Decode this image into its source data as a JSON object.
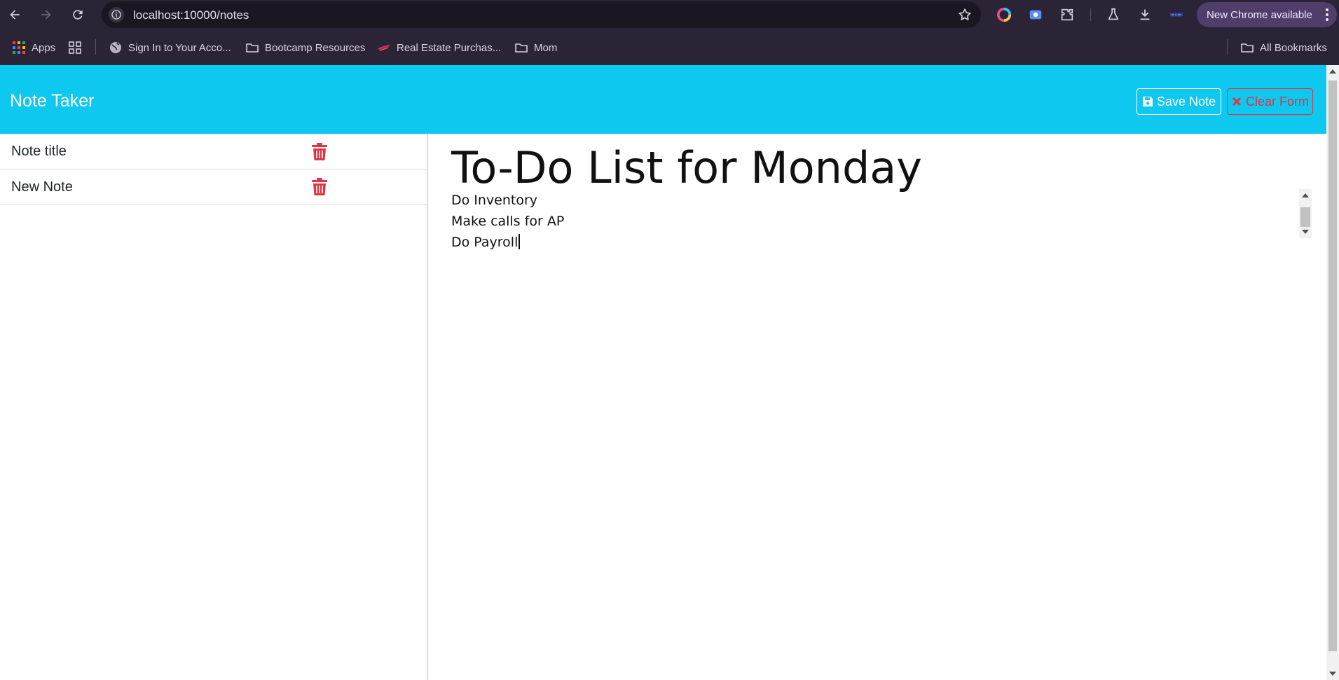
{
  "browser": {
    "url": "localhost:10000/notes",
    "update_label": "New Chrome available"
  },
  "bookmarks": {
    "items": [
      {
        "label": "Apps"
      },
      {
        "label": "Sign In to Your Acco..."
      },
      {
        "label": "Bootcamp Resources"
      },
      {
        "label": "Real Estate Purchas..."
      },
      {
        "label": "Mom"
      }
    ],
    "all_bookmarks": "All Bookmarks"
  },
  "header": {
    "brand": "Note Taker",
    "save_label": "Save Note",
    "clear_label": "Clear Form"
  },
  "sidebar": {
    "notes": [
      {
        "title": "Note title"
      },
      {
        "title": "New Note"
      }
    ]
  },
  "editor": {
    "title": "To-Do List for Monday",
    "lines": [
      "Do Inventory",
      "Make calls for AP",
      "Do Payroll"
    ]
  },
  "colors": {
    "header_bg": "#0ec8ef",
    "danger": "#dc3545",
    "chrome_bg": "#2b2336"
  }
}
